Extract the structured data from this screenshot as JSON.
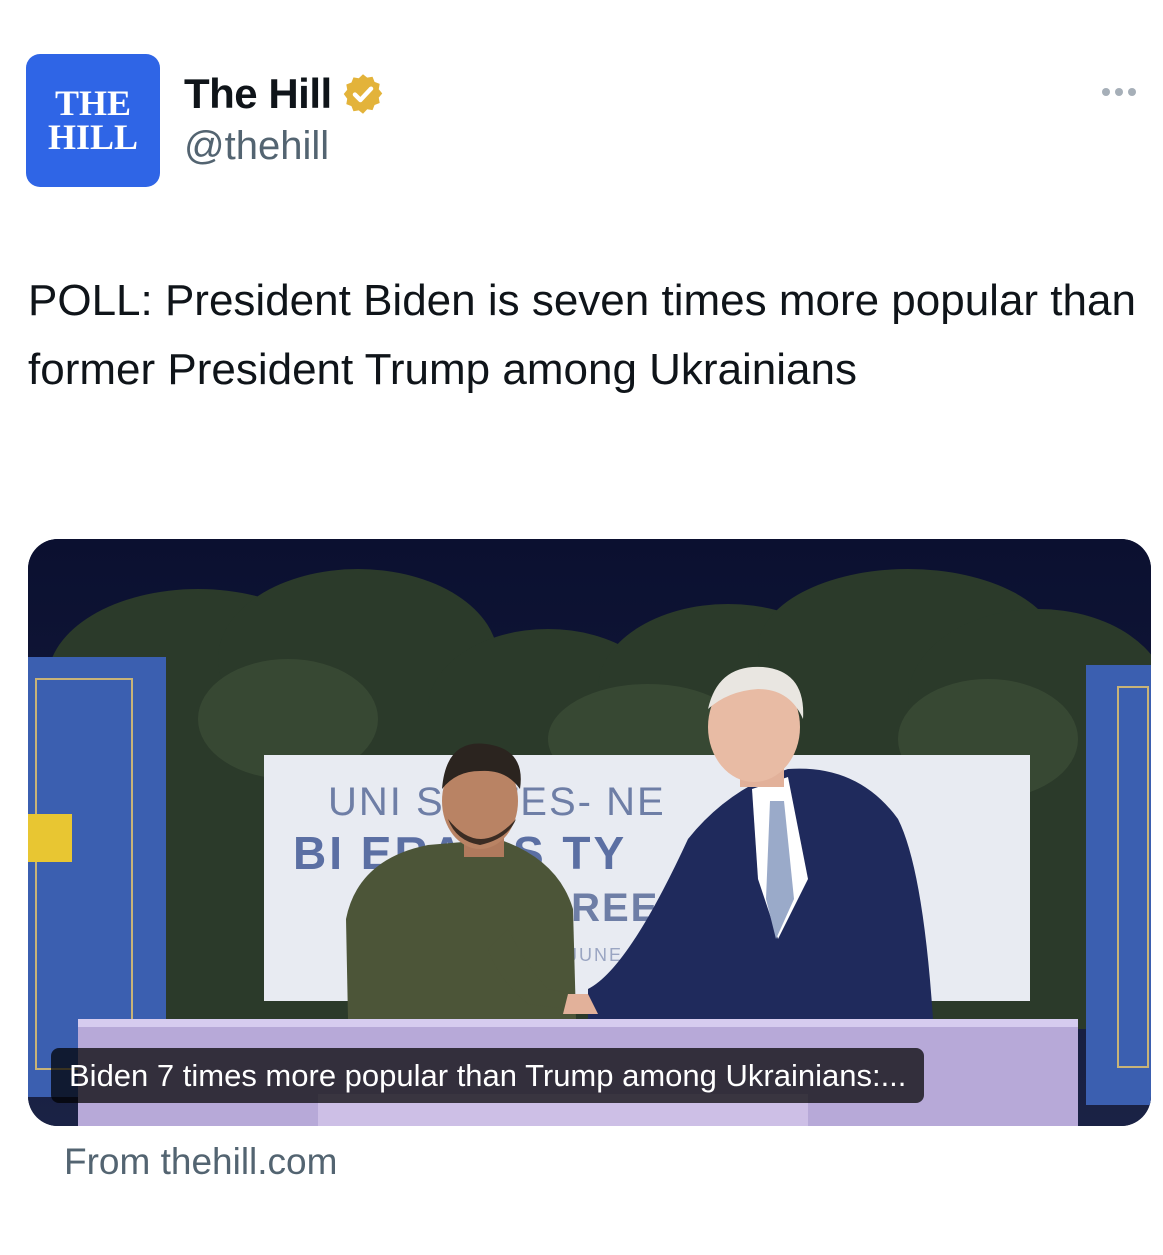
{
  "account": {
    "avatar_line1": "THE",
    "avatar_line2": "HILL",
    "display_name": "The Hill",
    "handle": "@thehill",
    "verified_badge_icon": "verified-gold-badge-icon",
    "more_icon": "more-options-icon"
  },
  "tweet": {
    "text": "POLL: President Biden is seven times more popular than former President Trump among Ukrainians"
  },
  "link_card": {
    "image_sign_line1": "UNI   STATES-        NE",
    "image_sign_line2": "BI    ERAL S    TY",
    "image_sign_line3": "GREEN",
    "image_sign_line4": "JUNE 1",
    "caption": "Biden 7 times more popular than Trump among Ukrainians:...",
    "source": "From thehill.com"
  },
  "colors": {
    "brand_blue": "#2f65e6",
    "verified_gold": "#e3b33a",
    "secondary_text": "#536471"
  }
}
